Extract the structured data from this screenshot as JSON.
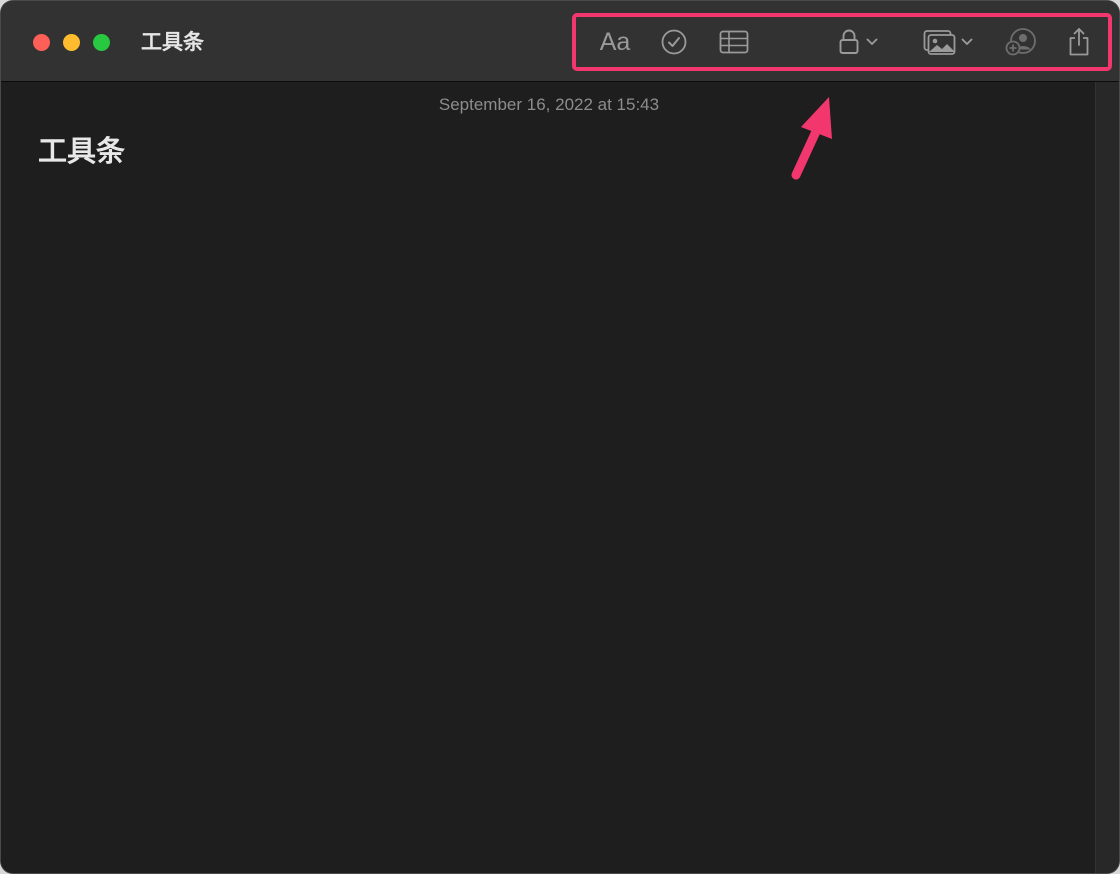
{
  "window": {
    "title": "工具条"
  },
  "toolbar": {
    "items": [
      {
        "name": "format-text",
        "label": "Aa",
        "icon": "text-format-icon"
      },
      {
        "name": "checklist",
        "icon": "checkmark-circle-icon"
      },
      {
        "name": "table",
        "icon": "table-icon"
      },
      {
        "name": "lock",
        "icon": "lock-icon",
        "has_menu": true
      },
      {
        "name": "media",
        "icon": "photo-icon",
        "has_menu": true
      },
      {
        "name": "collaborate",
        "icon": "add-person-icon"
      },
      {
        "name": "share",
        "icon": "share-icon"
      }
    ]
  },
  "note": {
    "date": "September 16, 2022 at 15:43",
    "title": "工具条"
  },
  "colors": {
    "annotation": "#f2376e",
    "background": "#1e1e1e",
    "titlebar": "#323232"
  }
}
